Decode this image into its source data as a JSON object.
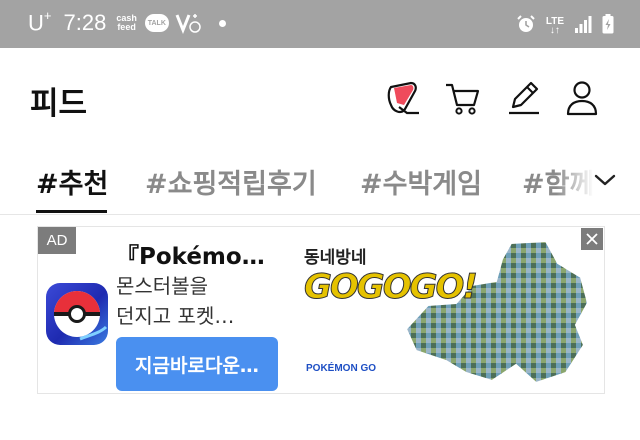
{
  "status_bar": {
    "carrier": "U",
    "carrier_sup": "+",
    "time": "7:28",
    "cashfeed_line1": "cash",
    "cashfeed_line2": "feed",
    "talk": "TALK",
    "network_line1": "LTE",
    "network_line2": "↓↑"
  },
  "header": {
    "title": "피드",
    "icons": [
      "sticker-icon",
      "cart-icon",
      "pencil-icon",
      "user-icon"
    ]
  },
  "tabs": {
    "items": [
      {
        "label": "#추천",
        "active": true
      },
      {
        "label": "#쇼핑적립후기",
        "active": false
      },
      {
        "label": "#수박게임",
        "active": false
      },
      {
        "label": "#함께걷기",
        "active": false
      }
    ]
  },
  "ad": {
    "badge": "AD",
    "title": "『Pokémo…",
    "desc_line1": "몬스터볼을",
    "desc_line2": "던지고 포켓…",
    "cta": "지금바로다운…",
    "banner_text": "동네방네",
    "banner_slogan": "GOGOGO!",
    "banner_brand": "POKÉMON GO"
  },
  "colors": {
    "status_bar_bg": "#a3a3a3",
    "cta_blue": "#4a90f0",
    "active_tab": "#111111",
    "inactive_tab": "#8a8a8a"
  }
}
